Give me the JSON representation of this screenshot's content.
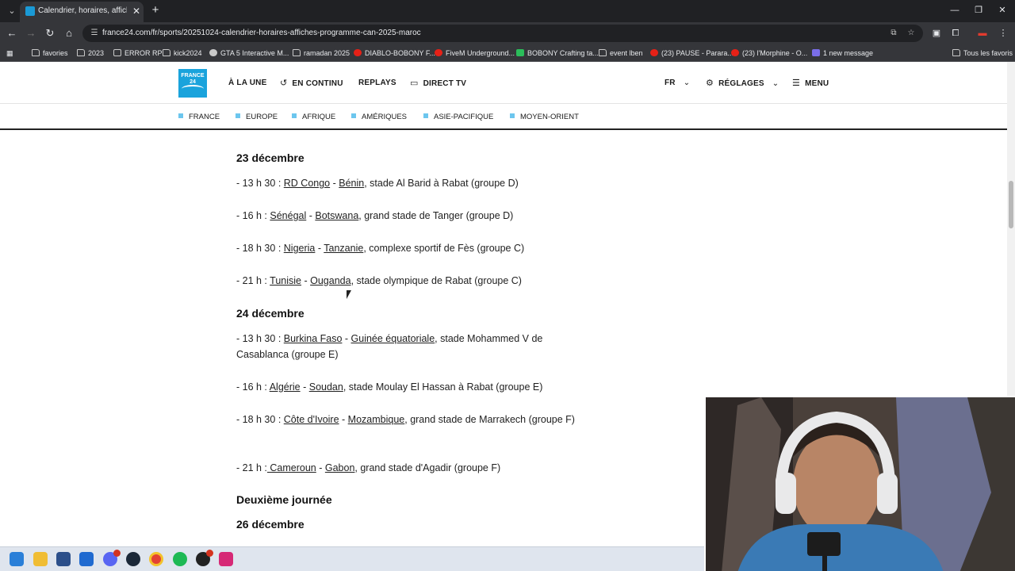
{
  "browser": {
    "tab": {
      "title": "Calendrier, horaires, affiches : la"
    },
    "url": "france24.com/fr/sports/20251024-calendrier-horaires-affiches-programme-can-2025-maroc",
    "bookmarks": [
      {
        "label": "favories",
        "icon": "folder-icon"
      },
      {
        "label": "2023",
        "icon": "folder-icon"
      },
      {
        "label": "ERROR RP",
        "icon": "page-icon"
      },
      {
        "label": "kick2024",
        "icon": "folder-icon"
      },
      {
        "label": "GTA 5 Interactive M...",
        "icon": "github-icon"
      },
      {
        "label": "ramadan 2025",
        "icon": "folder-icon"
      },
      {
        "label": "DIABLO-BOBONY F...",
        "icon": "youtube-icon"
      },
      {
        "label": "FiveM Underground...",
        "icon": "youtube-icon"
      },
      {
        "label": "BOBONY Crafting ta...",
        "icon": "sheets-icon"
      },
      {
        "label": "event lben",
        "icon": "folder-icon"
      },
      {
        "label": "(23) PAUSE - Parara...",
        "icon": "youtube-icon"
      },
      {
        "label": "(23) l'Morphine - O...",
        "icon": "youtube-icon"
      },
      {
        "label": "1 new message",
        "icon": "message-icon"
      }
    ],
    "all_bookmarks": "Tous les favoris"
  },
  "header": {
    "logo_text": "FRANCE 24",
    "nav": [
      {
        "label": "À LA UNE"
      },
      {
        "label": "EN CONTINU",
        "icon": "history-icon"
      },
      {
        "label": "REPLAYS"
      },
      {
        "label": "DIRECT TV",
        "icon": "tv-icon"
      }
    ],
    "language": "FR",
    "settings": "RÉGLAGES",
    "menu": "MENU"
  },
  "sections": [
    "FRANCE",
    "EUROPE",
    "AFRIQUE",
    "AMÉRIQUES",
    "ASIE-PACIFIQUE",
    "MOYEN-ORIENT"
  ],
  "article": {
    "day1": {
      "title": "23 décembre",
      "matches": [
        {
          "pre": "- 13 h 30 : ",
          "team1": "RD Congo",
          "sep": " - ",
          "team2": "Bénin",
          "post": ", stade Al Barid à Rabat (groupe D)"
        },
        {
          "pre": "- 16 h : ",
          "team1": "Sénégal",
          "sep": " - ",
          "team2": "Botswana",
          "post": ", grand stade de Tanger (groupe D)"
        },
        {
          "pre": "- 18 h 30 : ",
          "team1": "Nigeria",
          "sep": " - ",
          "team2": "Tanzanie",
          "post": ", complexe sportif de Fès (groupe C)"
        },
        {
          "pre": "- 21 h : ",
          "team1": "Tunisie",
          "sep": " - ",
          "team2": "Ouganda",
          "post": ", stade olympique de Rabat (groupe C)"
        }
      ]
    },
    "day2": {
      "title": "24 décembre",
      "matches": [
        {
          "pre": "- 13 h 30 : ",
          "team1": "Burkina Faso",
          "sep": " - ",
          "team2": "Guinée équatoriale",
          "post": ", stade Mohammed V de Casablanca (groupe E)"
        },
        {
          "pre": "- 16 h : ",
          "team1": "Algérie",
          "sep": " - ",
          "team2": "Soudan",
          "post": ", stade Moulay El Hassan à Rabat (groupe E)"
        },
        {
          "pre": "- 18 h 30 : ",
          "team1": "Côte d'Ivoire",
          "sep": " - ",
          "team2": "Mozambique",
          "post": ", grand stade de Marrakech (groupe F)"
        },
        {
          "pre": "- 21 h :",
          "team1": " Cameroun",
          "sep": " - ",
          "team2": "Gabon",
          "post": ", grand stade d'Agadir (groupe F)"
        }
      ]
    },
    "round_title": "Deuxième journée",
    "day3_title": "26 décembre"
  },
  "colors": {
    "brand": "#1aa3dc",
    "section_marker": "#6cc6ee",
    "chrome_dark": "#202124",
    "chrome_mid": "#35363a"
  }
}
